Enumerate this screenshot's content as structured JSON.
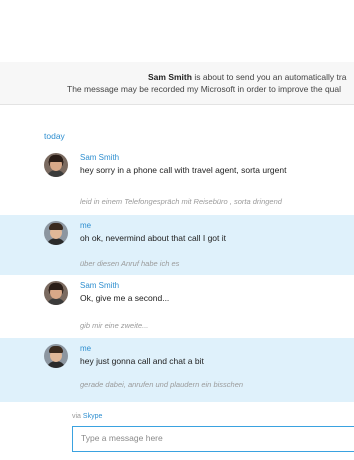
{
  "notice": {
    "name": "Sam Smith",
    "line1_rest": "is about to send you an automatically tra",
    "line2": "The message may be recorded my Microsoft in order to improve the qual"
  },
  "conversation": {
    "date_label": "today",
    "messages": [
      {
        "sender": "Sam Smith",
        "text": "hey sorry in a phone call with travel agent, sorta urgent",
        "translation": "leid in einem Telefongespräch mit Reisebüro , sorta dringend"
      },
      {
        "sender": "me",
        "text": "oh ok, nevermind about that call I got it",
        "translation": "über diesen Anruf habe ich es"
      },
      {
        "sender": "Sam Smith",
        "text": "Ok, give me a second...",
        "translation": "gib mir eine zweite..."
      },
      {
        "sender": "me",
        "text": "hey just gonna call and chat a bit",
        "translation": "gerade dabei, anrufen und plaudern ein bisschen"
      }
    ]
  },
  "composer": {
    "via_prefix": "via",
    "via_service": "Skype",
    "placeholder": "Type a message here"
  }
}
